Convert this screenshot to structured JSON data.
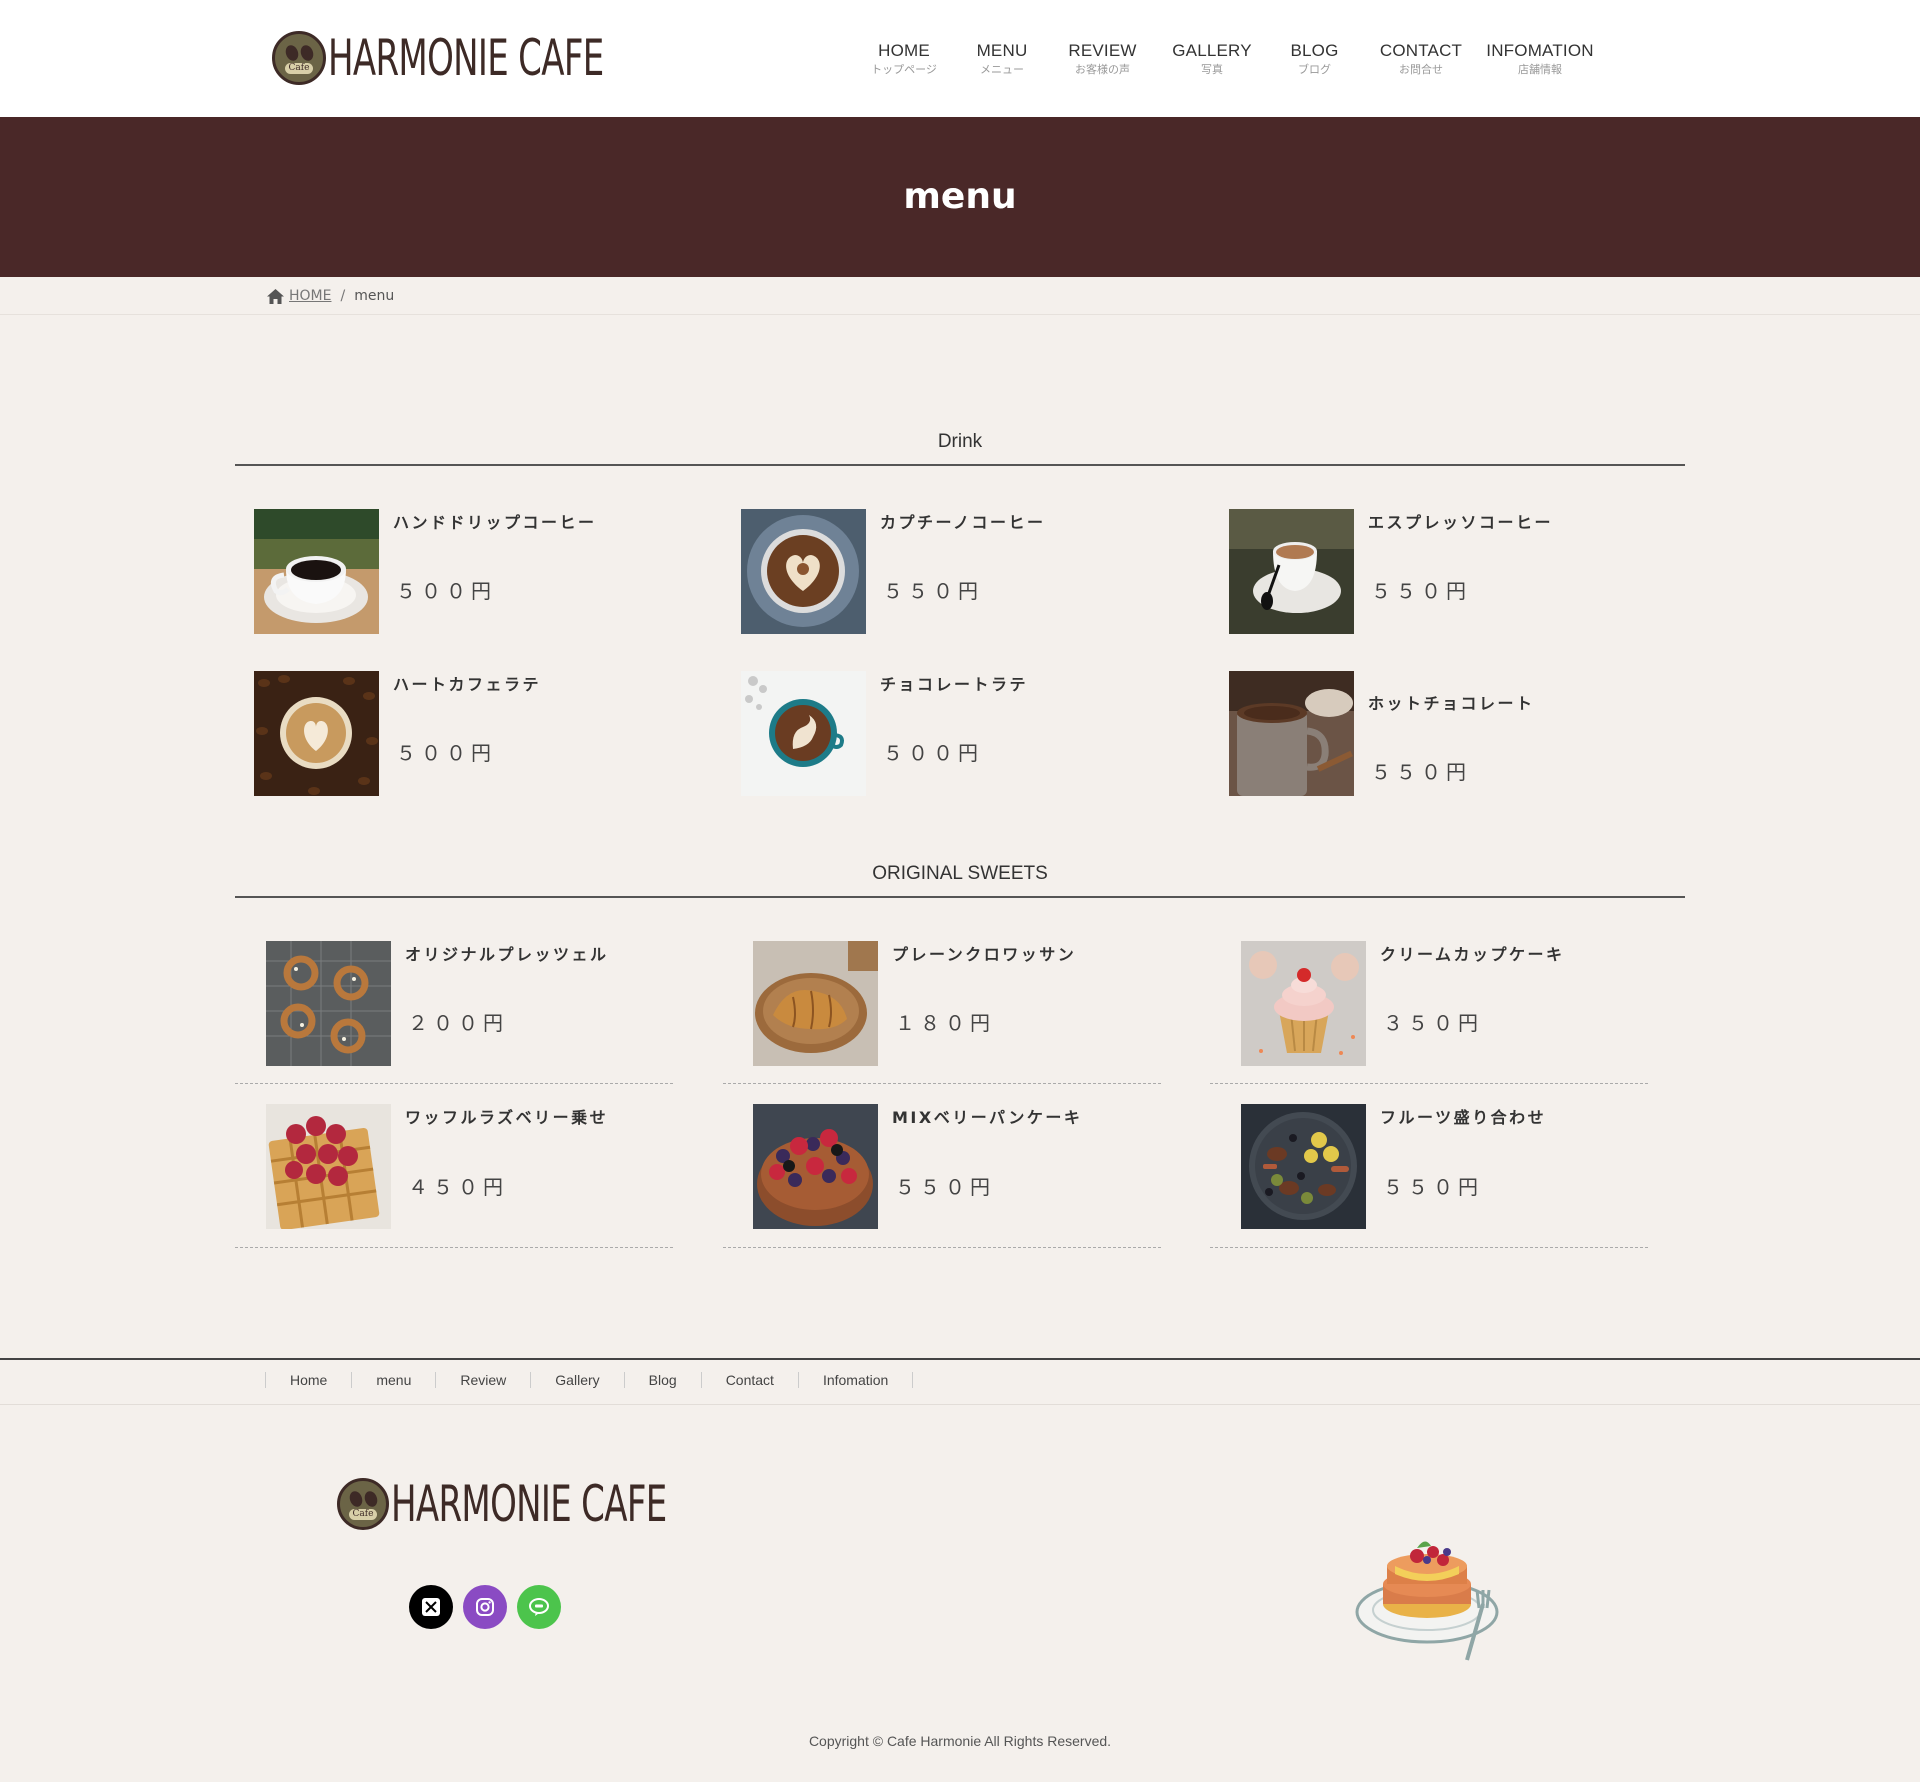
{
  "brand": {
    "logo_text": "HARMONIE CAFE",
    "badge_text": "Cafe"
  },
  "nav": [
    {
      "en": "HOME",
      "jp": "トップページ"
    },
    {
      "en": "MENU",
      "jp": "メニュー"
    },
    {
      "en": "REVIEW",
      "jp": "お客様の声"
    },
    {
      "en": "GALLERY",
      "jp": "写真"
    },
    {
      "en": "BLOG",
      "jp": "ブログ"
    },
    {
      "en": "CONTACT",
      "jp": "お問合せ"
    },
    {
      "en": "INFOMATION",
      "jp": "店舗情報"
    }
  ],
  "page_title": "menu",
  "breadcrumb": {
    "home": "HOME",
    "current": "menu"
  },
  "drink": {
    "title": "Drink",
    "items": [
      {
        "name": "ハンドドリップコーヒー",
        "price": "５００円",
        "image": "black-coffee-cup"
      },
      {
        "name": "カプチーノコーヒー",
        "price": "５５０円",
        "image": "cappuccino-heart"
      },
      {
        "name": "エスプレッソコーヒー",
        "price": "５５０円",
        "image": "espresso-cup"
      },
      {
        "name": "ハートカフェラテ",
        "price": "５００円",
        "image": "latte-on-beans"
      },
      {
        "name": "チョコレートラテ",
        "price": "５００円",
        "image": "chocolate-latte"
      },
      {
        "name": "ホットチョコレート",
        "price": "５５０円",
        "image": "hot-chocolate-mug"
      }
    ]
  },
  "sweets": {
    "title": "ORIGINAL SWEETS",
    "items": [
      {
        "name": "オリジナルプレッツェル",
        "price": "２００円",
        "image": "pretzels"
      },
      {
        "name": "プレーンクロワッサン",
        "price": "１８０円",
        "image": "croissant"
      },
      {
        "name": "クリームカップケーキ",
        "price": "３５０円",
        "image": "cupcake"
      },
      {
        "name": "ワッフルラズベリー乗せ",
        "price": "４５０円",
        "image": "waffle-raspberry"
      },
      {
        "name": "MIXベリーパンケーキ",
        "price": "５５０円",
        "image": "berry-pancake"
      },
      {
        "name": "フルーツ盛り合わせ",
        "price": "５５０円",
        "image": "fruit-platter"
      }
    ]
  },
  "footer": {
    "nav": [
      "Home",
      "menu",
      "Review",
      "Gallery",
      "Blog",
      "Contact",
      "Infomation"
    ],
    "social": [
      {
        "name": "x",
        "color": "#000000"
      },
      {
        "name": "instagram",
        "color": "#8a4bc3"
      },
      {
        "name": "line",
        "color": "#4cc44c"
      }
    ],
    "copyright": "Copyright © Cafe Harmonie All Rights Reserved."
  },
  "colors": {
    "band": "#4a2828",
    "background": "#f4f0ec",
    "brand_text": "#3d2a26"
  }
}
